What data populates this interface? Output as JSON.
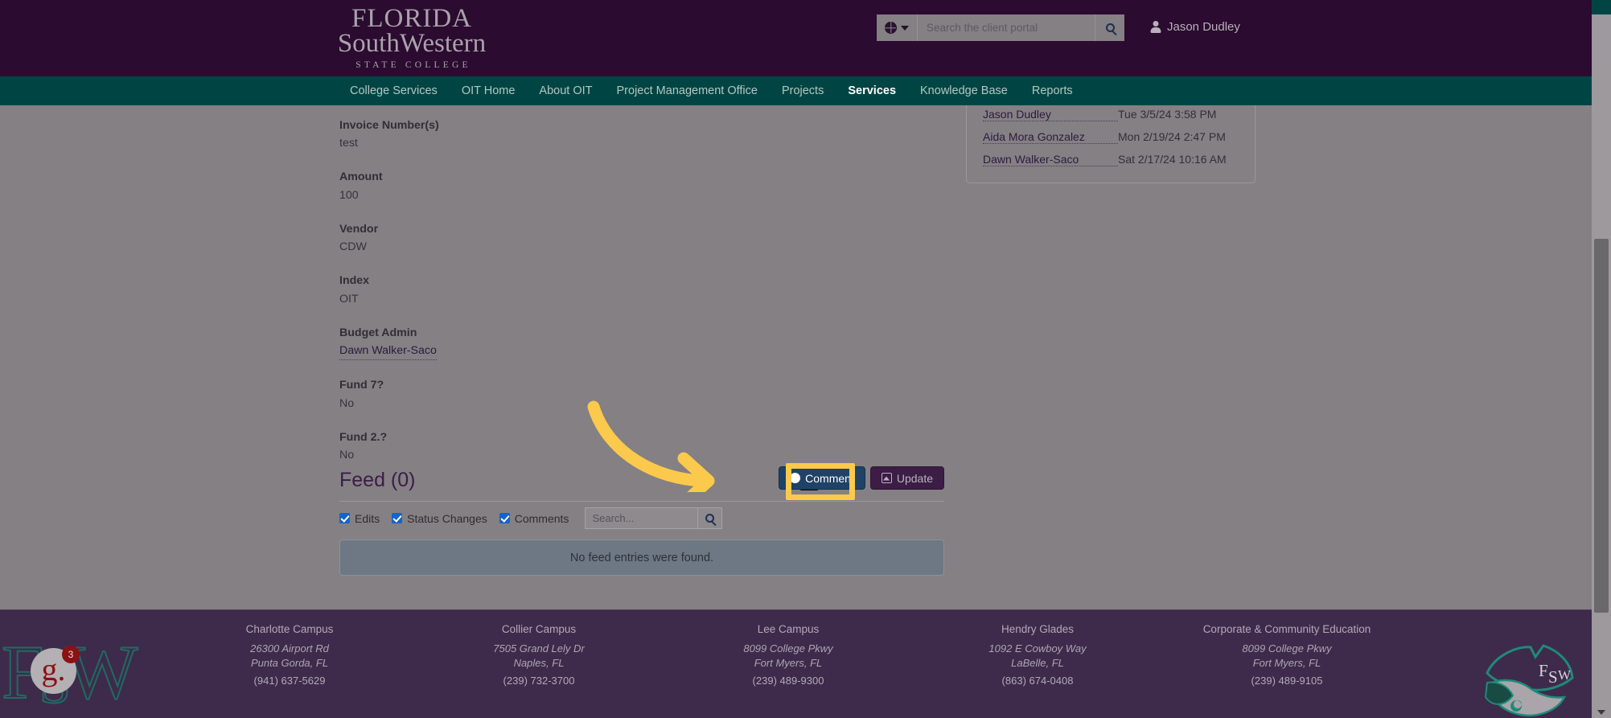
{
  "header": {
    "logo": {
      "line1": "FLORIDA",
      "line2": "SouthWestern",
      "line3": "STATE COLLEGE"
    },
    "search": {
      "placeholder": "Search the client portal",
      "value": "",
      "scope_icon": "globe-icon",
      "submit_icon": "search-icon"
    },
    "user": {
      "name": "Jason Dudley",
      "icon": "person-icon"
    }
  },
  "nav": {
    "items": [
      {
        "label": "College Services",
        "active": false
      },
      {
        "label": "OIT Home",
        "active": false
      },
      {
        "label": "About OIT",
        "active": false
      },
      {
        "label": "Project Management Office",
        "active": false
      },
      {
        "label": "Projects",
        "active": false
      },
      {
        "label": "Services",
        "active": true
      },
      {
        "label": "Knowledge Base",
        "active": false
      },
      {
        "label": "Reports",
        "active": false
      }
    ]
  },
  "ticket_fields": [
    {
      "label": "Invoice Number(s)",
      "value": "test",
      "is_link": false
    },
    {
      "label": "Amount",
      "value": "100",
      "is_link": false
    },
    {
      "label": "Vendor",
      "value": "CDW",
      "is_link": false
    },
    {
      "label": "Index",
      "value": "OIT",
      "is_link": false
    },
    {
      "label": "Budget Admin",
      "value": "Dawn Walker-Saco",
      "is_link": true
    },
    {
      "label": "Fund 7?",
      "value": "No",
      "is_link": false
    },
    {
      "label": "Fund 2.?",
      "value": "No",
      "is_link": false
    }
  ],
  "feed": {
    "title": "Feed (0)",
    "comment_button": "Comment",
    "update_button": "Update",
    "comment_icon": "comment-bubble-icon",
    "update_icon": "update-box-icon",
    "filters": [
      {
        "label": "Edits",
        "checked": true
      },
      {
        "label": "Status Changes",
        "checked": true
      },
      {
        "label": "Comments",
        "checked": true
      }
    ],
    "search": {
      "placeholder": "Search...",
      "value": "",
      "submit_icon": "search-icon"
    },
    "empty_message": "No feed entries were found."
  },
  "side_panel": {
    "rows": [
      {
        "name": "Jason Dudley",
        "date": "Tue 3/5/24 3:58 PM"
      },
      {
        "name": "Aida Mora Gonzalez",
        "date": "Mon 2/19/24 2:47 PM"
      },
      {
        "name": "Dawn Walker-Saco",
        "date": "Sat 2/17/24 10:16 AM"
      }
    ]
  },
  "footer": {
    "campuses": [
      {
        "name": "Charlotte Campus",
        "address1": "26300 Airport Rd",
        "address2": "Punta Gorda, FL",
        "phone": "(941) 637-5629"
      },
      {
        "name": "Collier Campus",
        "address1": "7505 Grand Lely Dr",
        "address2": "Naples, FL",
        "phone": "(239) 732-3700"
      },
      {
        "name": "Lee Campus",
        "address1": "8099 College Pkwy",
        "address2": "Fort Myers, FL",
        "phone": "(239) 489-9300"
      },
      {
        "name": "Hendry Glades",
        "address1": "1092 E Cowboy Way",
        "address2": "LaBelle, FL",
        "phone": "(863) 674-0408"
      },
      {
        "name": "Corporate & Community Education",
        "address1": "8099 College Pkwy",
        "address2": "Fort Myers, FL",
        "phone": "(239) 489-9105"
      }
    ],
    "wordmark": "FSW",
    "grammarly": {
      "letter": "g.",
      "count": "3"
    },
    "mascot_label": "FSW"
  },
  "colors": {
    "header_purple": "#2b0b30",
    "nav_teal": "#004543",
    "overlay_gray": "#848084",
    "footer_purple": "#3e2b4b",
    "accent_yellow": "#fbc94b",
    "comment_blue": "#1f4266",
    "update_purple": "#3b1d46",
    "checkbox_blue": "#1763c8"
  }
}
